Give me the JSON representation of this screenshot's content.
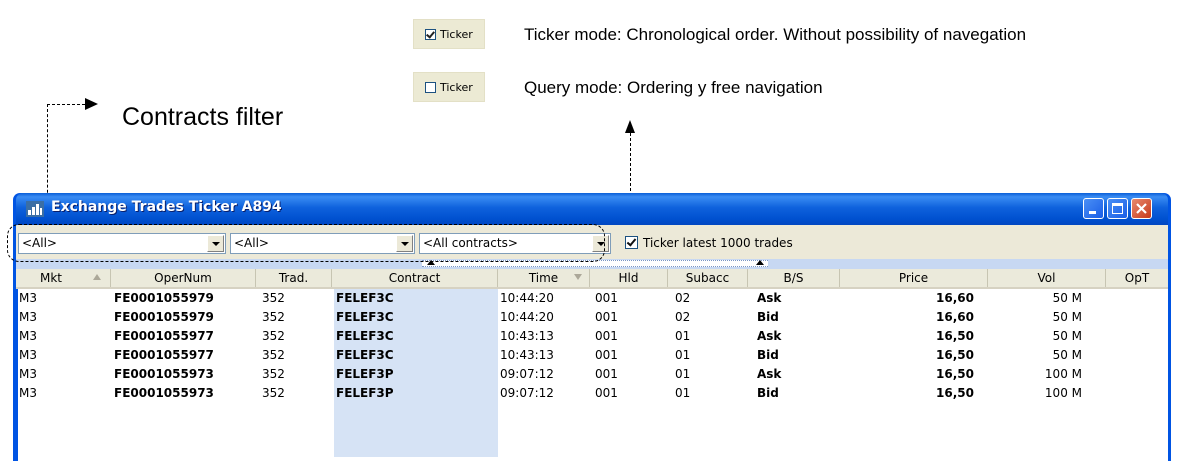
{
  "annotations": {
    "ticker_checked_label": "Ticker",
    "ticker_checked_desc": "Ticker mode: Chronological order. Without possibility of navegation",
    "ticker_unchecked_label": "Ticker",
    "ticker_unchecked_desc": "Query mode: Ordering y free navigation",
    "contracts_filter": "Contracts filter"
  },
  "window": {
    "title": "Exchange Trades Ticker A894",
    "filters": [
      "<All>",
      "<All>",
      "<All contracts>"
    ],
    "ticker_checkbox": {
      "label": "Ticker latest 1000 trades",
      "checked": true
    }
  },
  "table": {
    "columns": [
      "Mkt",
      "OperNum",
      "Trad.",
      "Contract",
      "Time",
      "Hld",
      "Subacc",
      "B/S",
      "Price",
      "Vol",
      "OpT"
    ],
    "rows": [
      [
        "M3",
        "FE0001055979",
        "352",
        "FELEF3C",
        "10:44:20",
        "001",
        "02",
        "Ask",
        "16,60",
        "50 M"
      ],
      [
        "M3",
        "FE0001055979",
        "352",
        "FELEF3C",
        "10:44:20",
        "001",
        "02",
        "Bid",
        "16,60",
        "50 M"
      ],
      [
        "M3",
        "FE0001055977",
        "352",
        "FELEF3C",
        "10:43:13",
        "001",
        "01",
        "Ask",
        "16,50",
        "50 M"
      ],
      [
        "M3",
        "FE0001055977",
        "352",
        "FELEF3C",
        "10:43:13",
        "001",
        "01",
        "Bid",
        "16,50",
        "50 M"
      ],
      [
        "M3",
        "FE0001055973",
        "352",
        "FELEF3P",
        "09:07:12",
        "001",
        "01",
        "Ask",
        "16,50",
        "100 M"
      ],
      [
        "M3",
        "FE0001055973",
        "352",
        "FELEF3P",
        "09:07:12",
        "001",
        "01",
        "Bid",
        "16,50",
        "100 M"
      ]
    ]
  }
}
